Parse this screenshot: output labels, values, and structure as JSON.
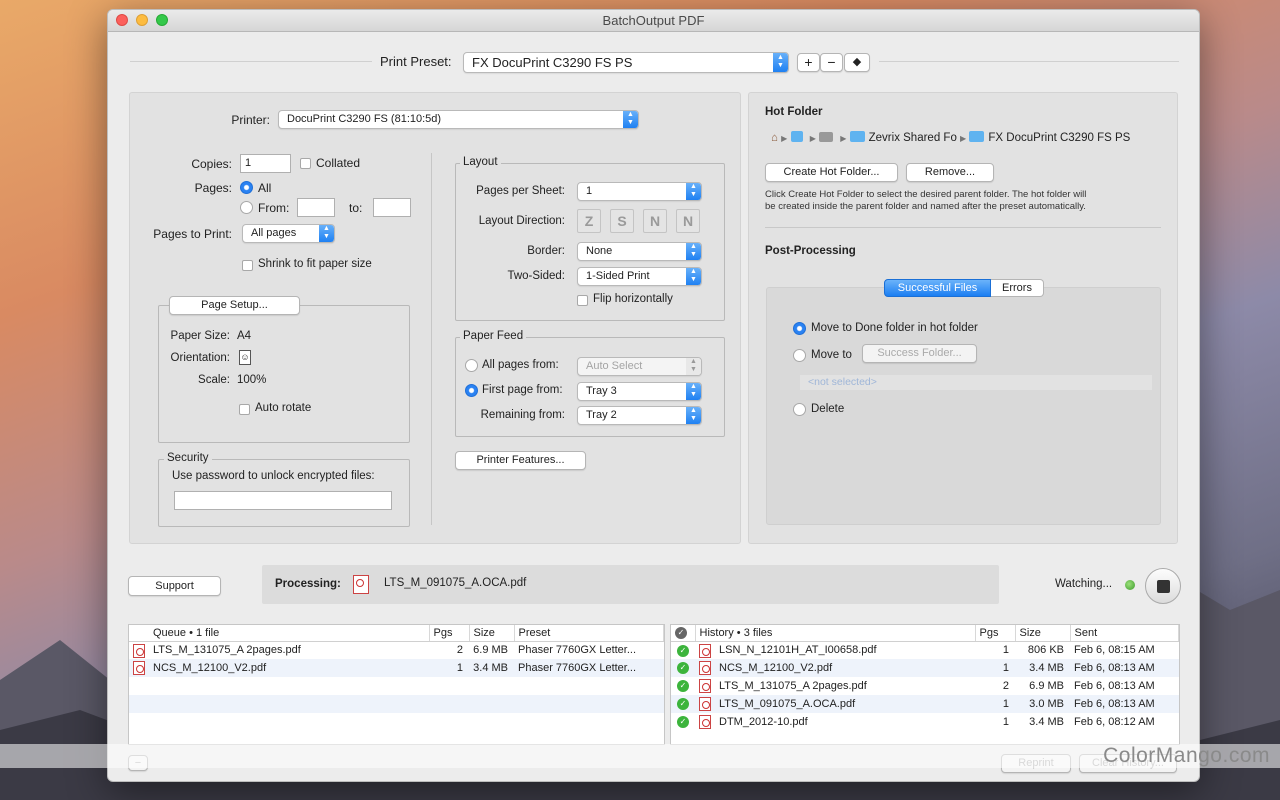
{
  "window": {
    "title": "BatchOutput PDF"
  },
  "preset": {
    "label": "Print Preset:",
    "value": "FX DocuPrint C3290 FS PS",
    "add": "+",
    "remove": "−"
  },
  "printer": {
    "label": "Printer:",
    "value": "DocuPrint C3290 FS (81:10:5d)",
    "copies_label": "Copies:",
    "copies_value": "1",
    "collated_label": "Collated",
    "pages_label": "Pages:",
    "pages_all": "All",
    "pages_from": "From:",
    "pages_to": "to:",
    "pages_to_print_label": "Pages to Print:",
    "pages_to_print_value": "All pages",
    "shrink_label": "Shrink to fit paper size"
  },
  "page_setup": {
    "button": "Page Setup...",
    "paper_size_label": "Paper Size:",
    "paper_size_value": "A4",
    "orientation_label": "Orientation:",
    "scale_label": "Scale:",
    "scale_value": "100%",
    "auto_rotate_label": "Auto rotate"
  },
  "security": {
    "title": "Security",
    "label": "Use password to unlock encrypted files:"
  },
  "layout": {
    "title": "Layout",
    "pps_label": "Pages per Sheet:",
    "pps_value": "1",
    "direction_label": "Layout Direction:",
    "directions": [
      "Z",
      "S",
      "N",
      "N"
    ],
    "border_label": "Border:",
    "border_value": "None",
    "two_sided_label": "Two-Sided:",
    "two_sided_value": "1-Sided Print",
    "flip_label": "Flip horizontally"
  },
  "paper_feed": {
    "title": "Paper Feed",
    "all_label": "All pages from:",
    "all_value": "Auto Select",
    "first_label": "First page from:",
    "first_value": "Tray 3",
    "remaining_label": "Remaining from:",
    "remaining_value": "Tray 2"
  },
  "printer_features": "Printer Features...",
  "hot_folder": {
    "title": "Hot Folder",
    "path": [
      "Zevrix Shared Fo",
      "FX DocuPrint C3290 FS PS"
    ],
    "create": "Create Hot Folder...",
    "remove": "Remove...",
    "help_line1": "Click Create Hot Folder to select the desired parent folder. The hot folder will",
    "help_line2": "be created inside the parent folder and named after the preset automatically."
  },
  "post_processing": {
    "title": "Post-Processing",
    "tabs": [
      "Successful Files",
      "Errors"
    ],
    "move_done": "Move to Done folder in hot folder",
    "move_to": "Move to",
    "success_folder": "Success Folder...",
    "not_selected": "<not selected>",
    "delete": "Delete"
  },
  "status": {
    "support": "Support",
    "processing_label": "Processing:",
    "processing_file": "LTS_M_091075_A.OCA.pdf",
    "watching": "Watching..."
  },
  "queue": {
    "headers": [
      "Queue • 1 file",
      "Pgs",
      "Size",
      "Preset"
    ],
    "rows": [
      {
        "name": "LTS_M_131075_A 2pages.pdf",
        "pgs": "2",
        "size": "6.9 MB",
        "preset": "Phaser 7760GX Letter..."
      },
      {
        "name": "NCS_M_12100_V2.pdf",
        "pgs": "1",
        "size": "3.4 MB",
        "preset": "Phaser 7760GX Letter..."
      }
    ],
    "remove": "−"
  },
  "history": {
    "headers": [
      "History • 3 files",
      "Pgs",
      "Size",
      "Sent"
    ],
    "rows": [
      {
        "name": "LSN_N_12101H_AT_I00658.pdf",
        "pgs": "1",
        "size": "806 KB",
        "sent": "Feb 6, 08:15 AM"
      },
      {
        "name": "NCS_M_12100_V2.pdf",
        "pgs": "1",
        "size": "3.4 MB",
        "sent": "Feb 6, 08:13 AM"
      },
      {
        "name": "LTS_M_131075_A 2pages.pdf",
        "pgs": "2",
        "size": "6.9 MB",
        "sent": "Feb 6, 08:13 AM"
      },
      {
        "name": "LTS_M_091075_A.OCA.pdf",
        "pgs": "1",
        "size": "3.0 MB",
        "sent": "Feb 6, 08:13 AM"
      },
      {
        "name": "DTM_2012-10.pdf",
        "pgs": "1",
        "size": "3.4 MB",
        "sent": "Feb 6, 08:12 AM"
      }
    ],
    "reprint": "Reprint",
    "clear": "Clear History..."
  },
  "watermark": "ColorMango.com"
}
